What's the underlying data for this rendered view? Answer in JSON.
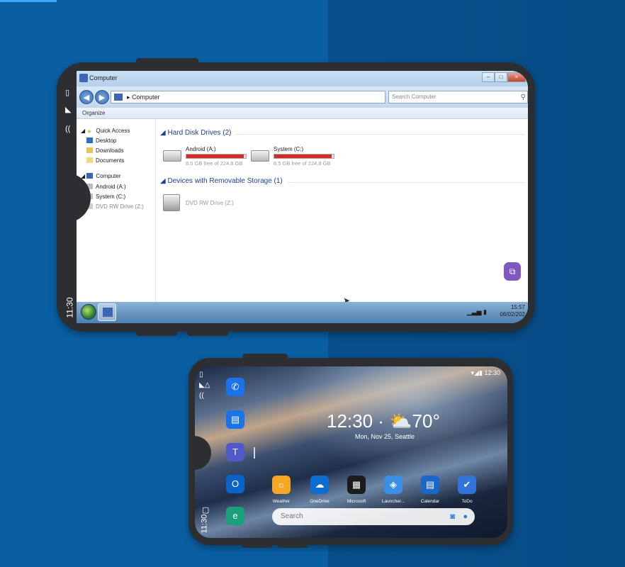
{
  "phone1": {
    "status_time": "11:30",
    "window": {
      "title": "Computer",
      "address": "Computer",
      "search_placeholder": "Search Computer",
      "organize": "Organize",
      "nav": [
        {
          "label": "Quick Access"
        },
        {
          "label": "Desktop"
        },
        {
          "label": "Downloads"
        },
        {
          "label": "Documents"
        },
        {
          "label": "Computer"
        },
        {
          "label": "Android (A:)"
        },
        {
          "label": "System (C:)"
        },
        {
          "label": "DVD RW Drive (Z:)"
        }
      ],
      "groups": {
        "hdd": "Hard Disk Drives (2)",
        "removable": "Devices with Removable Storage (1)"
      },
      "drives": [
        {
          "name": "Android (A:)",
          "free": "8.5 GB free of 224.8 GB",
          "used_fraction": 0.96
        },
        {
          "name": "System (C:)",
          "free": "8.5 GB free of 224.8 GB",
          "used_fraction": 0.96
        }
      ],
      "dvd": {
        "name": "DVD RW Drive (Z:)"
      },
      "taskbar": {
        "time": "15:57",
        "date": "06/02/202"
      }
    }
  },
  "phone2": {
    "status_time_right": "12:30",
    "status_time_vertical": "11:30",
    "clock": "12:30 · ⛅70°",
    "date_location": "Mon, Nov 25, Seattle",
    "apps": [
      {
        "label": "Weather",
        "color": "#f5a623"
      },
      {
        "label": "OneDrive",
        "color": "#0f6cd1"
      },
      {
        "label": "Microsoft",
        "color": "#1b1b1b"
      },
      {
        "label": "Launcher...",
        "color": "#3a8ee6"
      },
      {
        "label": "Calendar",
        "color": "#1a66c9"
      },
      {
        "label": "ToDo",
        "color": "#2f74d6"
      }
    ],
    "dock": [
      {
        "icon": "phone-icon",
        "color": "#1a73e8"
      },
      {
        "icon": "messages-icon",
        "color": "#1a73e8"
      },
      {
        "icon": "teams-icon",
        "color": "#5059c9"
      },
      {
        "icon": "outlook-icon",
        "color": "#0a64c8"
      },
      {
        "icon": "edge-icon",
        "color": "#1a9f7a"
      }
    ],
    "search_placeholder": "Search"
  }
}
